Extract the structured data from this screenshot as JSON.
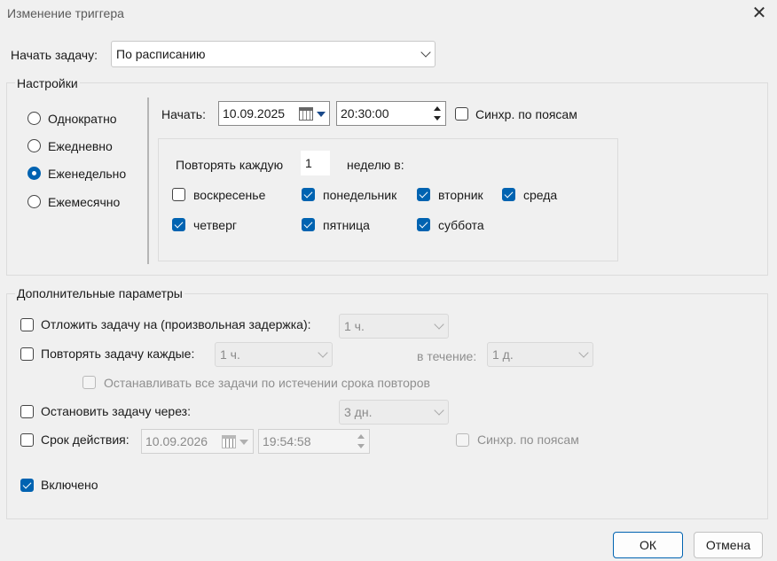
{
  "window": {
    "title": "Изменение триггера",
    "close_icon": "close-icon"
  },
  "start_task": {
    "label": "Начать задачу:",
    "value": "По расписанию"
  },
  "settings": {
    "legend": "Настройки",
    "radios": [
      {
        "label": "Однократно",
        "checked": false
      },
      {
        "label": "Ежедневно",
        "checked": false
      },
      {
        "label": "Еженедельно",
        "checked": true
      },
      {
        "label": "Ежемесячно",
        "checked": false
      }
    ],
    "start_label": "Начать:",
    "start_date": "10.09.2025",
    "start_time": "20:30:00",
    "sync_tz_label": "Синхр. по поясам",
    "repeat_every_label": "Повторять каждую",
    "repeat_every_value": "1",
    "weeks_on_label": "неделю в:",
    "days": [
      {
        "label": "воскресенье",
        "checked": false
      },
      {
        "label": "понедельник",
        "checked": true
      },
      {
        "label": "вторник",
        "checked": true
      },
      {
        "label": "среда",
        "checked": true
      },
      {
        "label": "четверг",
        "checked": true
      },
      {
        "label": "пятница",
        "checked": true
      },
      {
        "label": "суббота",
        "checked": true
      }
    ]
  },
  "advanced": {
    "legend": "Дополнительные параметры",
    "delay_label": "Отложить задачу на (произвольная задержка):",
    "delay_value": "1 ч.",
    "repeat_label": "Повторять задачу каждые:",
    "repeat_value": "1 ч.",
    "duration_label": "в течение:",
    "duration_value": "1 д.",
    "stop_all_label": "Останавливать все задачи по истечении срока повторов",
    "stop_after_label": "Остановить задачу через:",
    "stop_after_value": "3 дн.",
    "expire_label": "Срок действия:",
    "expire_date": "10.09.2026",
    "expire_time": "19:54:58",
    "expire_sync_label": "Синхр. по поясам",
    "enabled_label": "Включено"
  },
  "buttons": {
    "ok": "ОК",
    "cancel": "Отмена"
  }
}
